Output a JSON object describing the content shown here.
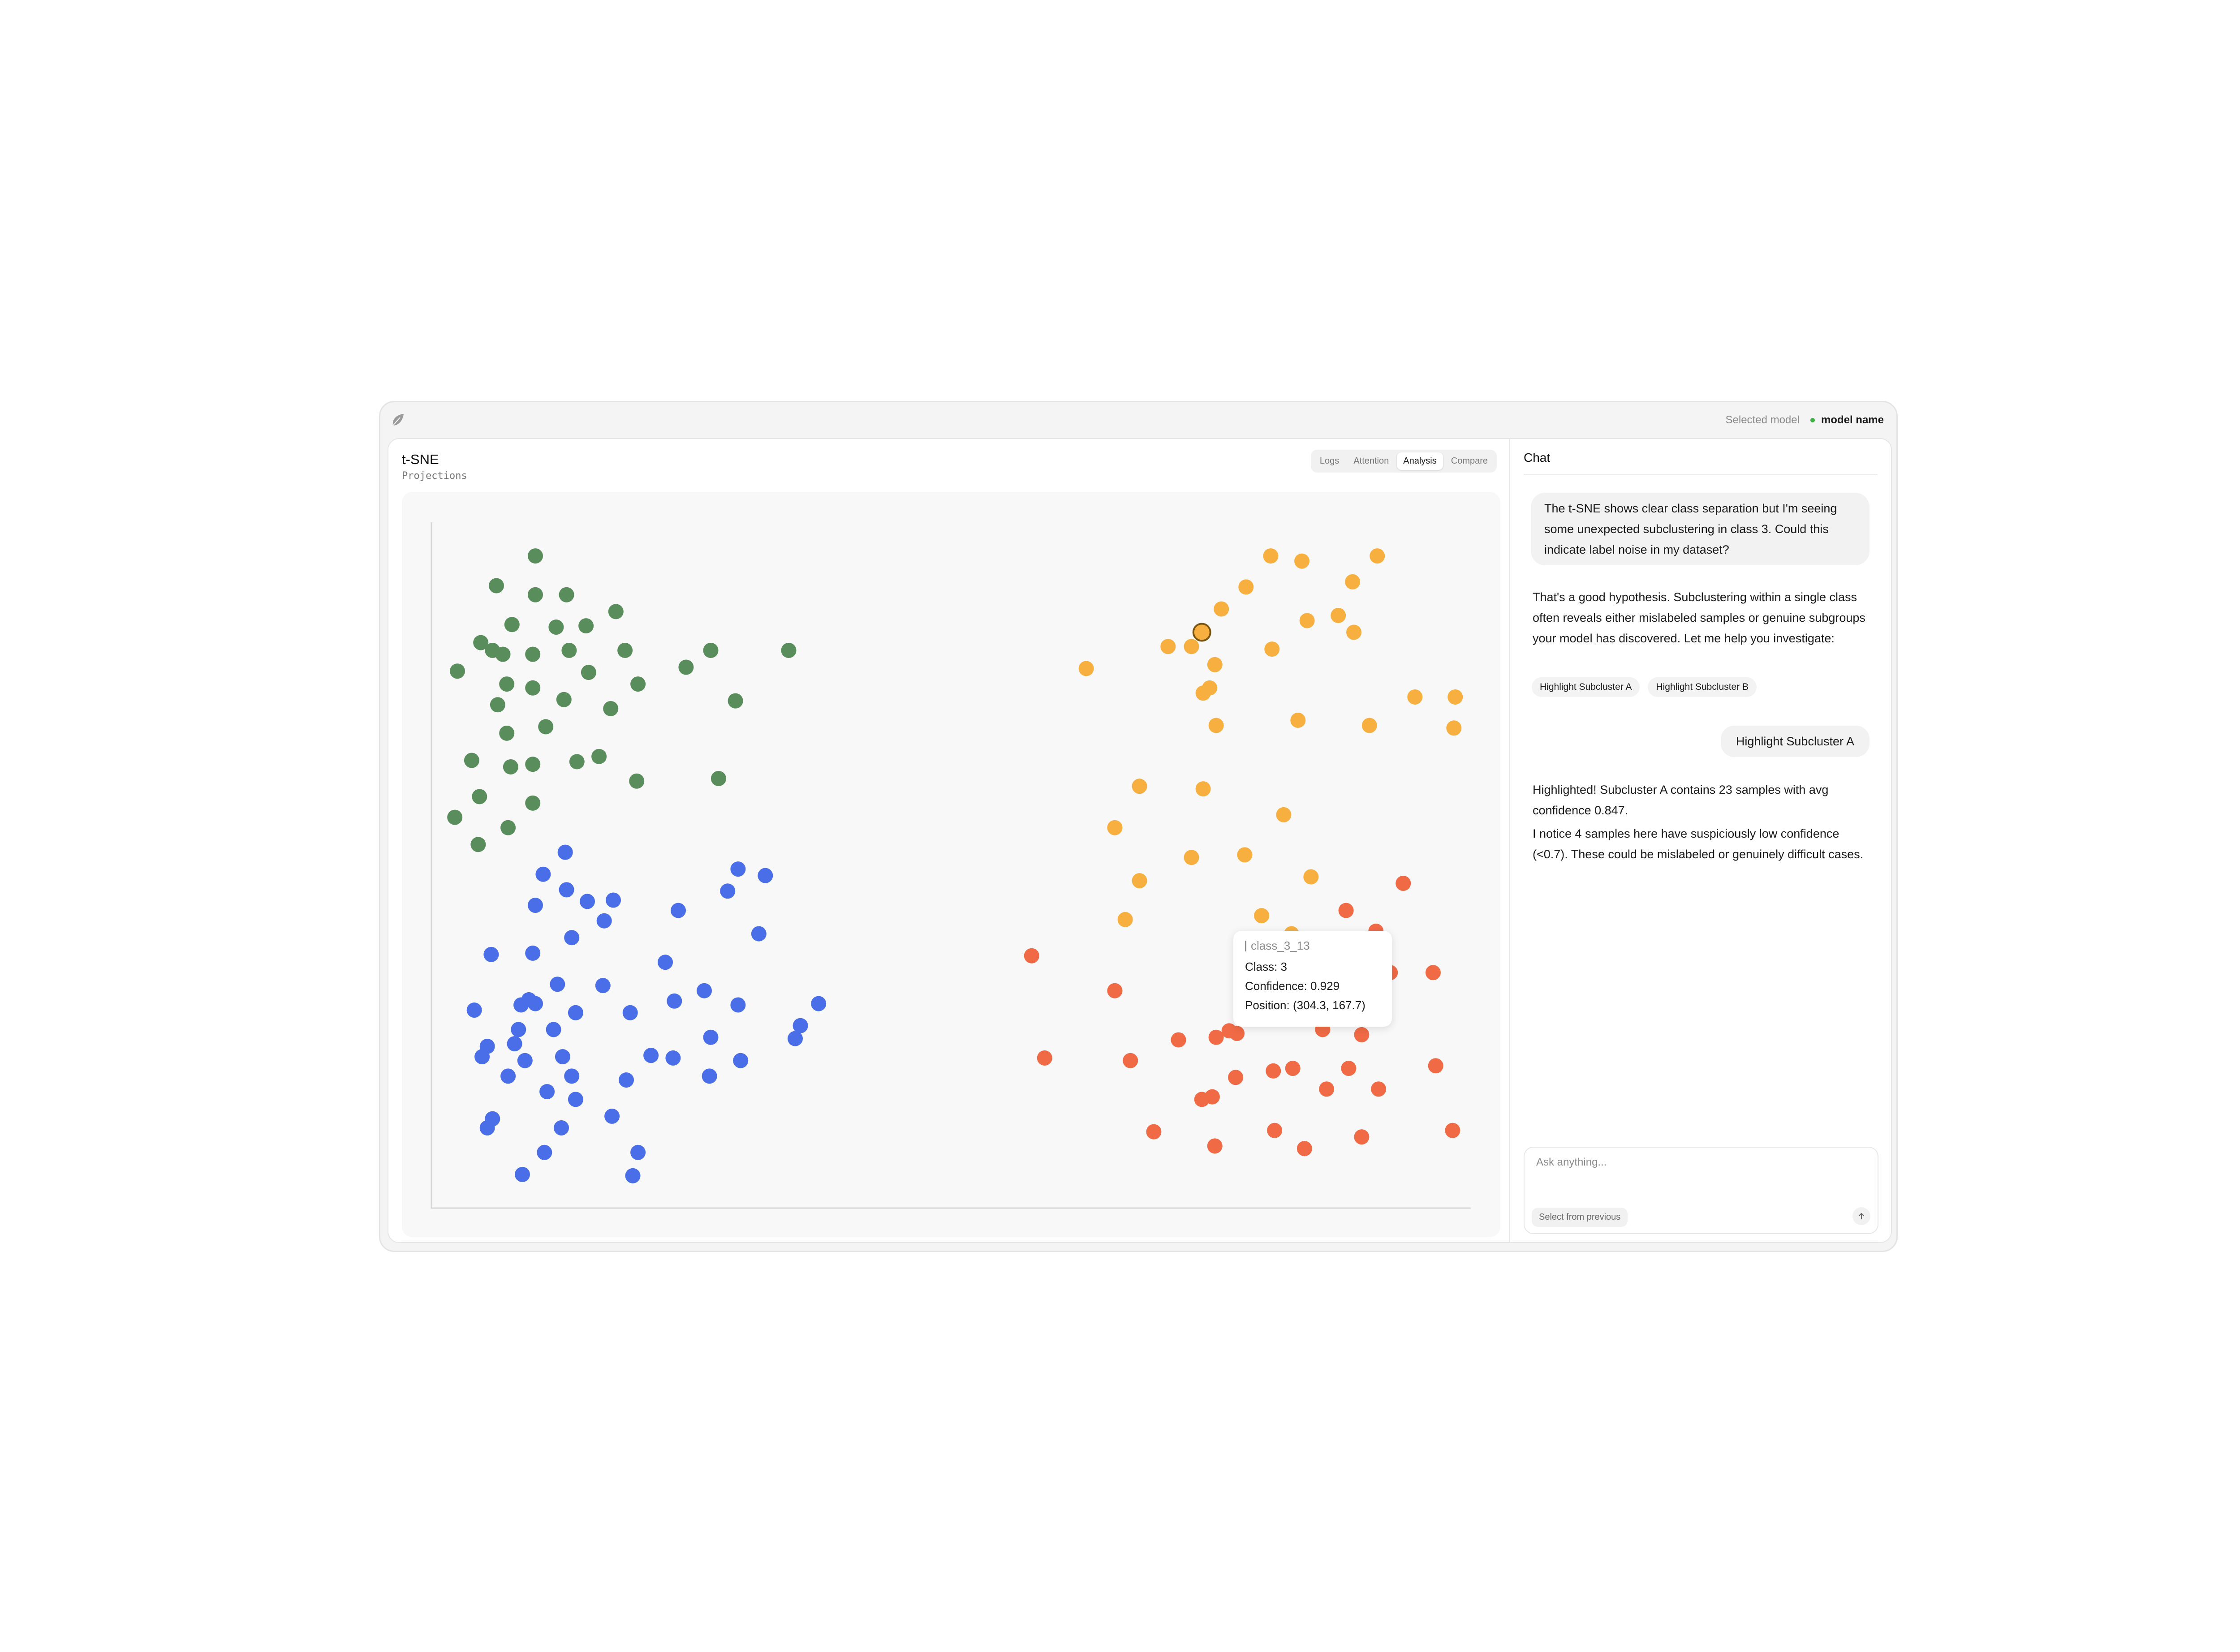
{
  "app": {
    "logo_icon": "leaf-icon",
    "model_selector_label": "Selected model",
    "model_name": "model name",
    "model_status_color": "#3cb043"
  },
  "main": {
    "title": "t-SNE",
    "subtitle": "Projections",
    "tabs": [
      {
        "label": "Logs",
        "active": false
      },
      {
        "label": "Attention",
        "active": false
      },
      {
        "label": "Analysis",
        "active": true
      },
      {
        "label": "Compare",
        "active": false
      }
    ]
  },
  "chart_data": {
    "type": "scatter",
    "title": "",
    "xlabel": "",
    "ylabel": "",
    "xlim": [
      0,
      800
    ],
    "ylim": [
      0,
      530
    ],
    "grid": false,
    "legend": "none",
    "series": [
      {
        "color": "#5a8d5c",
        "points": [
          [
            80,
            504
          ],
          [
            50,
            481
          ],
          [
            80,
            474
          ],
          [
            104,
            474
          ],
          [
            142,
            461
          ],
          [
            62,
            451
          ],
          [
            96,
            449
          ],
          [
            119,
            450
          ],
          [
            38,
            437
          ],
          [
            47,
            431
          ],
          [
            55,
            428
          ],
          [
            106,
            431
          ],
          [
            149,
            431
          ],
          [
            215,
            431
          ],
          [
            275,
            431
          ],
          [
            78,
            428
          ],
          [
            196,
            418
          ],
          [
            20,
            415
          ],
          [
            121,
            414
          ],
          [
            58,
            405
          ],
          [
            78,
            402
          ],
          [
            159,
            405
          ],
          [
            234,
            392
          ],
          [
            51,
            389
          ],
          [
            102,
            393
          ],
          [
            138,
            386
          ],
          [
            88,
            372
          ],
          [
            58,
            367
          ],
          [
            31,
            346
          ],
          [
            61,
            341
          ],
          [
            78,
            343
          ],
          [
            112,
            345
          ],
          [
            129,
            349
          ],
          [
            158,
            330
          ],
          [
            221,
            332
          ],
          [
            37,
            318
          ],
          [
            78,
            313
          ],
          [
            18,
            302
          ],
          [
            59,
            294
          ],
          [
            36,
            281
          ]
        ]
      },
      {
        "color": "#4a6ee8",
        "points": [
          [
            103,
            275
          ],
          [
            86,
            258
          ],
          [
            104,
            246
          ],
          [
            236,
            262
          ],
          [
            257,
            257
          ],
          [
            228,
            245
          ],
          [
            80,
            234
          ],
          [
            120,
            237
          ],
          [
            140,
            238
          ],
          [
            190,
            230
          ],
          [
            133,
            222
          ],
          [
            252,
            212
          ],
          [
            108,
            209
          ],
          [
            46,
            196
          ],
          [
            78,
            197
          ],
          [
            180,
            190
          ],
          [
            97,
            173
          ],
          [
            132,
            172
          ],
          [
            210,
            168
          ],
          [
            75,
            161
          ],
          [
            69,
            157
          ],
          [
            80,
            158
          ],
          [
            187,
            160
          ],
          [
            33,
            153
          ],
          [
            111,
            151
          ],
          [
            153,
            151
          ],
          [
            236,
            157
          ],
          [
            298,
            158
          ],
          [
            67,
            138
          ],
          [
            94,
            138
          ],
          [
            284,
            141
          ],
          [
            64,
            127
          ],
          [
            43,
            125
          ],
          [
            215,
            132
          ],
          [
            280,
            131
          ],
          [
            39,
            117
          ],
          [
            101,
            117
          ],
          [
            169,
            118
          ],
          [
            186,
            116
          ],
          [
            72,
            114
          ],
          [
            238,
            114
          ],
          [
            59,
            102
          ],
          [
            108,
            102
          ],
          [
            214,
            102
          ],
          [
            150,
            99
          ],
          [
            89,
            90
          ],
          [
            111,
            84
          ],
          [
            47,
            69
          ],
          [
            139,
            71
          ],
          [
            100,
            62
          ],
          [
            43,
            62
          ],
          [
            87,
            43
          ],
          [
            159,
            43
          ],
          [
            70,
            26
          ],
          [
            155,
            25
          ]
        ]
      },
      {
        "color": "#f7b040",
        "points": [
          [
            646,
            504
          ],
          [
            670,
            500
          ],
          [
            728,
            504
          ],
          [
            627,
            480
          ],
          [
            709,
            484
          ],
          [
            608,
            463
          ],
          [
            674,
            454
          ],
          [
            698,
            458
          ],
          [
            710,
            445
          ],
          [
            567,
            434
          ],
          [
            585,
            434
          ],
          [
            647,
            432
          ],
          [
            603,
            420
          ],
          [
            504,
            417
          ],
          [
            599,
            402
          ],
          [
            594,
            398
          ],
          [
            757,
            395
          ],
          [
            788,
            395
          ],
          [
            787,
            371
          ],
          [
            667,
            377
          ],
          [
            722,
            373
          ],
          [
            604,
            373
          ],
          [
            545,
            326
          ],
          [
            594,
            324
          ],
          [
            656,
            304
          ],
          [
            526,
            294
          ],
          [
            585,
            271
          ],
          [
            626,
            273
          ],
          [
            677,
            256
          ],
          [
            545,
            253
          ],
          [
            639,
            226
          ],
          [
            534,
            223
          ],
          [
            662,
            212
          ]
        ]
      },
      {
        "color": "#f06a46",
        "points": [
          [
            748,
            251
          ],
          [
            704,
            230
          ],
          [
            727,
            214
          ],
          [
            713,
            196
          ],
          [
            462,
            195
          ],
          [
            738,
            182
          ],
          [
            771,
            182
          ],
          [
            689,
            172
          ],
          [
            526,
            168
          ],
          [
            686,
            138
          ],
          [
            716,
            134
          ],
          [
            575,
            130
          ],
          [
            604,
            132
          ],
          [
            614,
            137
          ],
          [
            620,
            135
          ],
          [
            472,
            116
          ],
          [
            538,
            114
          ],
          [
            648,
            106
          ],
          [
            663,
            108
          ],
          [
            706,
            108
          ],
          [
            773,
            110
          ],
          [
            619,
            101
          ],
          [
            689,
            92
          ],
          [
            729,
            92
          ],
          [
            601,
            86
          ],
          [
            593,
            84
          ],
          [
            556,
            59
          ],
          [
            649,
            60
          ],
          [
            786,
            60
          ],
          [
            716,
            55
          ],
          [
            603,
            48
          ],
          [
            672,
            46
          ]
        ]
      }
    ],
    "highlighted_point": {
      "x": 593,
      "y": 445,
      "color": "#f7b040",
      "outline": "#7a5510"
    },
    "tooltip": {
      "id": "class_3_13",
      "class_line": "Class: 3",
      "confidence_line": "Confidence: 0.929",
      "position_line": "Position: (304.3, 167.7)"
    }
  },
  "chat": {
    "title": "Chat",
    "messages": [
      {
        "role": "user",
        "text": "The t-SNE shows clear class separation but I'm seeing some unexpected subclustering in class 3. Could this indicate label noise in my dataset?"
      },
      {
        "role": "assistant",
        "text": "That's a good hypothesis. Subclustering within a single class often reveals either mislabeled samples or genuine subgroups your model has discovered. Let me help you investigate:"
      },
      {
        "role": "user",
        "text": "Highlight Subcluster A"
      },
      {
        "role": "assistant",
        "text": "Highlighted! Subcluster A contains 23 samples with avg confidence 0.847.",
        "text2": "I notice 4 samples here have suspiciously low confidence (<0.7). These could be mislabeled or genuinely difficult cases."
      }
    ],
    "suggestions": [
      "Highlight Subcluster A",
      "Highlight Subcluster B"
    ],
    "input": {
      "placeholder": "Ask anything...",
      "value": "",
      "select_previous_label": "Select from previous",
      "send_icon": "arrow-up-icon"
    }
  }
}
